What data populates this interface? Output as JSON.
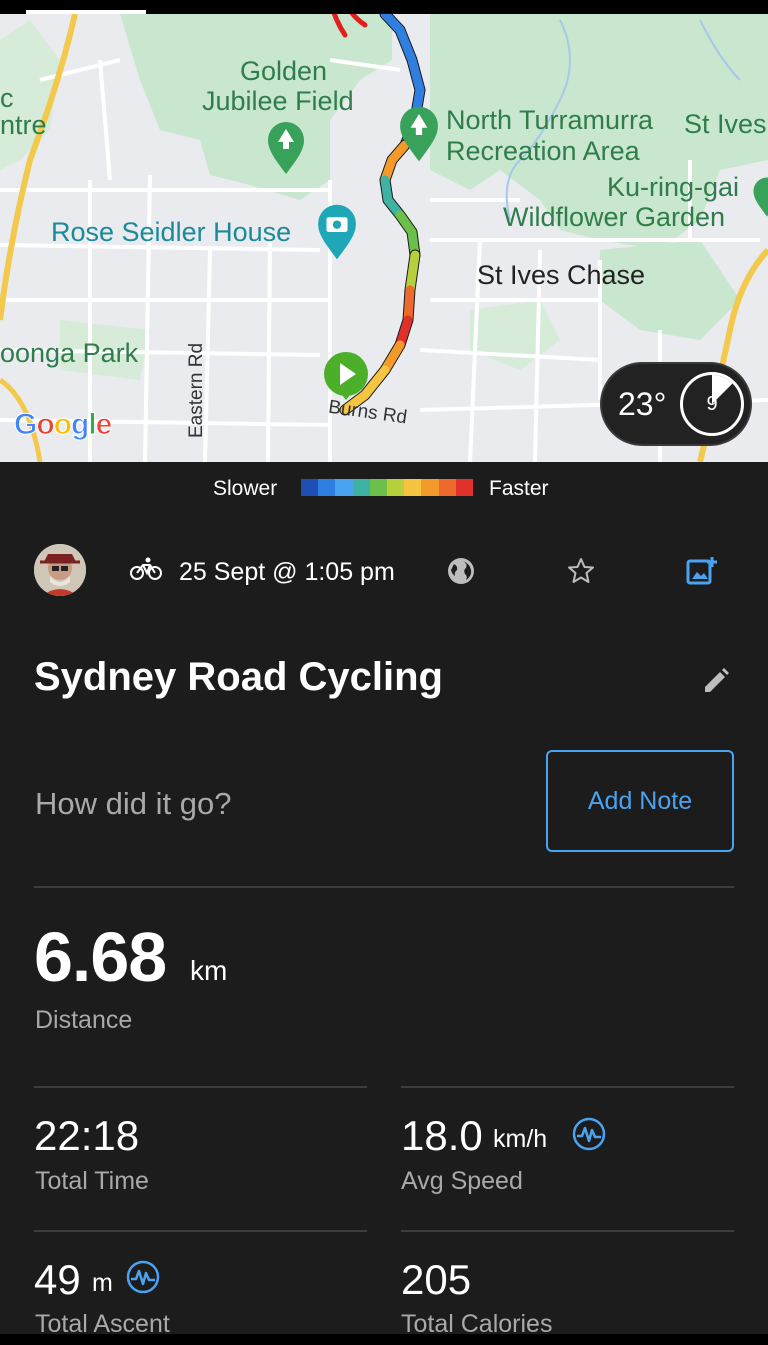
{
  "map": {
    "labels": {
      "golden_jubilee_1": "Golden",
      "golden_jubilee_2": "Jubilee Field",
      "north_turramurra_1": "North Turramurra",
      "north_turramurra_2": "Recreation Area",
      "st_ives_top": "St Ives",
      "kuringgai_1": "Ku-ring-gai",
      "kuringgai_2": "Wildflower Garden",
      "rose_seidler": "Rose Seidler House",
      "st_ives_chase": "St Ives Chase",
      "partial_park": "oonga Park",
      "partial_c": "c",
      "partial_ntre": "ntre",
      "partial_bottom": "Tl'oonga",
      "eastern_rd": "Eastern Rd",
      "burns_rd": "Burns Rd"
    },
    "google_logo": [
      "G",
      "o",
      "o",
      "g",
      "l",
      "e"
    ],
    "google_colors": [
      "#4285F4",
      "#EA4335",
      "#FBBC05",
      "#4285F4",
      "#34A853",
      "#EA4335"
    ],
    "weather": {
      "temp": "23°",
      "value": "9"
    }
  },
  "legend": {
    "slower": "Slower",
    "faster": "Faster",
    "colors": [
      "#1f4fb5",
      "#2f7fe0",
      "#4aa3f0",
      "#3fb3a3",
      "#6cc04a",
      "#b7cf3a",
      "#f5c542",
      "#f39a2b",
      "#ec6a2b",
      "#e0302a"
    ]
  },
  "activity": {
    "type_icon": "bike-icon",
    "date": "25 Sept @ 1:05 pm",
    "title": "Sydney Road Cycling",
    "note_placeholder": "How did it go?",
    "add_note_label": "Add Note"
  },
  "stats": {
    "distance": {
      "value": "6.68",
      "unit": "km",
      "label": "Distance"
    },
    "total_time": {
      "value": "22:18",
      "label": "Total Time"
    },
    "avg_speed": {
      "value": "18.0",
      "unit": "km/h",
      "label": "Avg Speed"
    },
    "total_ascent": {
      "value": "49",
      "unit": "m",
      "label": "Total Ascent"
    },
    "total_calories": {
      "value": "205",
      "label": "Total Calories"
    }
  },
  "colors": {
    "accent": "#4aa3f0",
    "background": "#1c1c1c",
    "start_marker": "#4caf2a"
  }
}
